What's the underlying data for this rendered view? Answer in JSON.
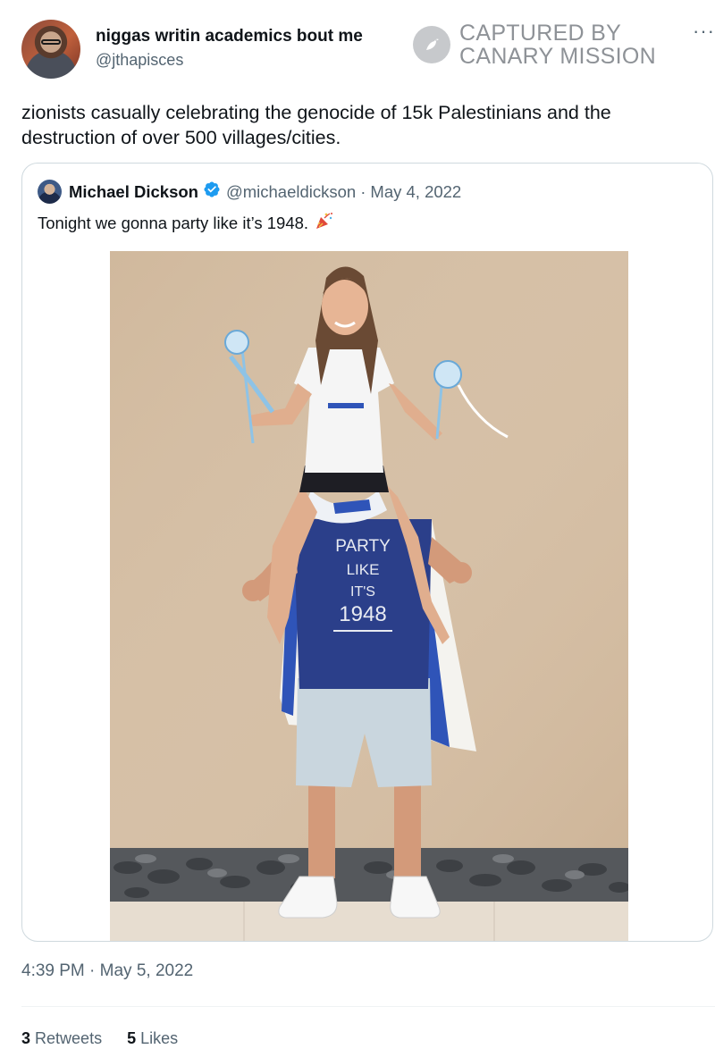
{
  "tweet": {
    "author_name": "niggas writin academics bout me",
    "author_handle": "@jthapisces",
    "text": "zionists casually celebrating the genocide of 15k Palestinians and the destruction of over 500 villages/cities.",
    "timestamp": "4:39 PM · May 5, 2022",
    "retweets_count": "3",
    "retweets_label": "Retweets",
    "likes_count": "5",
    "likes_label": "Likes",
    "more_icon": "more-dots-icon"
  },
  "watermark": {
    "line1": "CAPTURED BY",
    "line2": "CANARY MISSION",
    "icon": "canary-bird-icon"
  },
  "quoted": {
    "name": "Michael Dickson",
    "handle": "@michaeldickson",
    "separator": "·",
    "date": "May 4, 2022",
    "text": "Tonight we gonna party like it’s 1948.",
    "emoji_icon": "party-popper-icon",
    "verified_icon": "verified-badge-icon",
    "shirt": {
      "line1": "PARTY",
      "line2": "LIKE",
      "line3": "IT'S",
      "line4": "1948"
    }
  },
  "colors": {
    "text": "#0f1419",
    "muted": "#536471",
    "border": "#cfd9de",
    "verified": "#1d9bf0",
    "wall": "#d6bfa6",
    "shirt": "#2b3f8a"
  }
}
